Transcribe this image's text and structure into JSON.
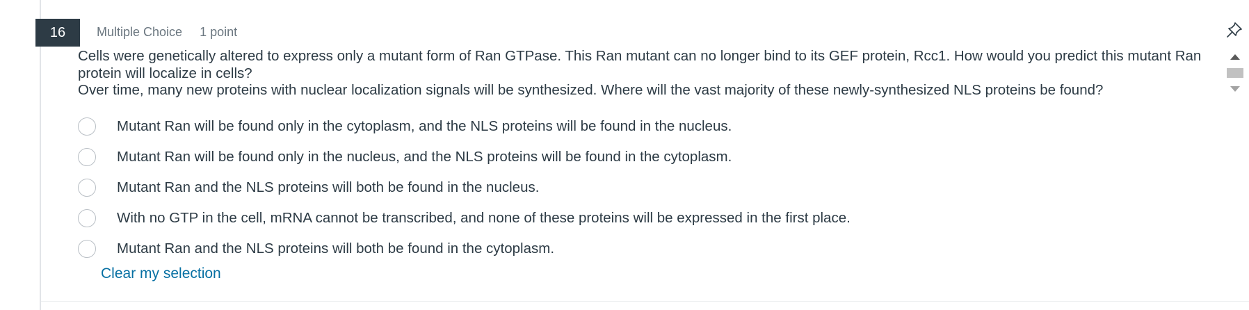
{
  "question": {
    "number": "16",
    "type_label": "Multiple Choice",
    "points_label": "1 point",
    "stem_line_1": "Cells were genetically altered to express only a mutant form of Ran GTPase. This Ran mutant can no longer bind to its GEF protein, Rcc1. How would you predict this mutant Ran protein will localize in cells?",
    "stem_line_2": "Over time, many new proteins with nuclear localization signals will be synthesized. Where will the vast majority of these newly-synthesized NLS proteins be found?"
  },
  "options": [
    "Mutant Ran will be found only in the cytoplasm, and the NLS proteins will be found in the nucleus.",
    "Mutant Ran will be found only in the nucleus, and the NLS proteins will be found in the cytoplasm.",
    "Mutant Ran and the NLS proteins will both be found in the nucleus.",
    "With no GTP in the cell, mRNA cannot be transcribed, and none of these proteins will be expressed in the first place.",
    "Mutant Ran and the NLS proteins will both be found in the cytoplasm."
  ],
  "clear_selection_label": "Clear my selection",
  "icons": {
    "pin": "pin-icon",
    "scroll_up": "chevron-up-icon",
    "scroll_down": "chevron-down-icon",
    "radio": "radio-unselected-icon"
  },
  "colors": {
    "number_badge_bg": "#2d3b45",
    "text": "#2d3b45",
    "muted_text": "#6b7780",
    "link": "#0770a3",
    "radio_border": "#b9bfc5"
  }
}
